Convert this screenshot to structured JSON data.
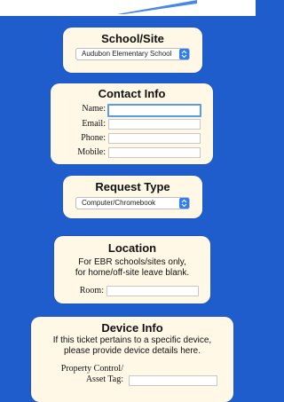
{
  "school_site": {
    "title": "School/Site",
    "selected": "Audubon Elementary School"
  },
  "contact_info": {
    "title": "Contact Info",
    "name_label": "Name:",
    "email_label": "Email:",
    "phone_label": "Phone:",
    "mobile_label": "Mobile:"
  },
  "request_type": {
    "title": "Request Type",
    "selected": "Computer/Chromebook"
  },
  "location": {
    "title": "Location",
    "line1": "For EBR schools/sites only,",
    "line2": "for home/off-site leave blank.",
    "room_label": "Room:"
  },
  "device_info": {
    "title": "Device Info",
    "line1": "If this ticket pertains to a specific device,",
    "line2": "please provide device details here.",
    "property_label_line1": "Property Control/",
    "property_label_line2": "Asset Tag:"
  },
  "colors": {
    "background": "#1f5ccc",
    "card": "#fff8e7",
    "select_arrow": "#2e7cf6",
    "focus_ring": "#5b9bea"
  }
}
